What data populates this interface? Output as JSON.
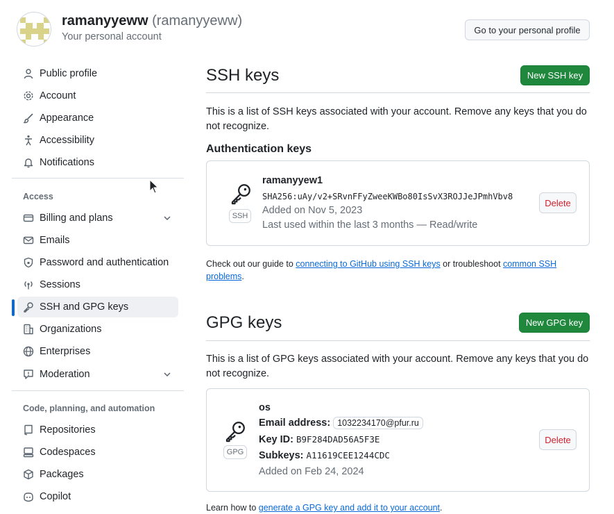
{
  "header": {
    "display_name": "ramanyyeww",
    "login": "(ramanyyeww)",
    "subtitle": "Your personal account",
    "profile_button": "Go to your personal profile"
  },
  "sidebar": {
    "items_top": [
      {
        "label": "Public profile",
        "icon": "person-icon"
      },
      {
        "label": "Account",
        "icon": "gear-icon"
      },
      {
        "label": "Appearance",
        "icon": "paintbrush-icon"
      },
      {
        "label": "Accessibility",
        "icon": "accessibility-icon"
      },
      {
        "label": "Notifications",
        "icon": "bell-icon"
      }
    ],
    "access_heading": "Access",
    "items_access": [
      {
        "label": "Billing and plans",
        "icon": "credit-card-icon"
      },
      {
        "label": "Emails",
        "icon": "mail-icon"
      },
      {
        "label": "Password and authentication",
        "icon": "shield-lock-icon"
      },
      {
        "label": "Sessions",
        "icon": "broadcast-icon"
      },
      {
        "label": "SSH and GPG keys",
        "icon": "key-icon"
      },
      {
        "label": "Organizations",
        "icon": "organization-icon"
      },
      {
        "label": "Enterprises",
        "icon": "globe-icon"
      },
      {
        "label": "Moderation",
        "icon": "report-icon"
      }
    ],
    "code_heading": "Code, planning, and automation",
    "items_code": [
      {
        "label": "Repositories",
        "icon": "repo-icon"
      },
      {
        "label": "Codespaces",
        "icon": "codespaces-icon"
      },
      {
        "label": "Packages",
        "icon": "package-icon"
      },
      {
        "label": "Copilot",
        "icon": "copilot-icon"
      }
    ],
    "active_item": "SSH and GPG keys"
  },
  "ssh": {
    "title": "SSH keys",
    "new_button": "New SSH key",
    "description": "This is a list of SSH keys associated with your account. Remove any keys that you do not recognize.",
    "auth_heading": "Authentication keys",
    "key": {
      "badge": "SSH",
      "name": "ramanyyew1",
      "fingerprint": "SHA256:uAy/v2+SRvnFFyZweeKWBo80IsSvX3ROJJeJPmhVbv8",
      "added": "Added on Nov 5, 2023",
      "last_used": "Last used within the last 3 months — Read/write",
      "delete": "Delete"
    },
    "guide": {
      "pre": "Check out our guide to ",
      "link1": "connecting to GitHub using SSH keys",
      "mid": " or troubleshoot ",
      "link2": "common SSH problems",
      "post": "."
    }
  },
  "gpg": {
    "title": "GPG keys",
    "new_button": "New GPG key",
    "description": "This is a list of GPG keys associated with your account. Remove any keys that you do not recognize.",
    "key": {
      "badge": "GPG",
      "name": "os",
      "email_label": "Email address:",
      "email": "1032234170@pfur.ru",
      "keyid_label": "Key ID:",
      "keyid": "B9F284DAD56A5F3E",
      "subkeys_label": "Subkeys:",
      "subkeys": "A11619CEE1244CDC",
      "added": "Added on Feb 24, 2024",
      "delete": "Delete"
    },
    "learn": {
      "pre": "Learn how to ",
      "link": "generate a GPG key and add it to your account",
      "post": "."
    }
  },
  "colors": {
    "primary_button": "#1f883d",
    "link": "#0969da",
    "danger": "#cf222e",
    "active_indicator": "#0969da"
  }
}
